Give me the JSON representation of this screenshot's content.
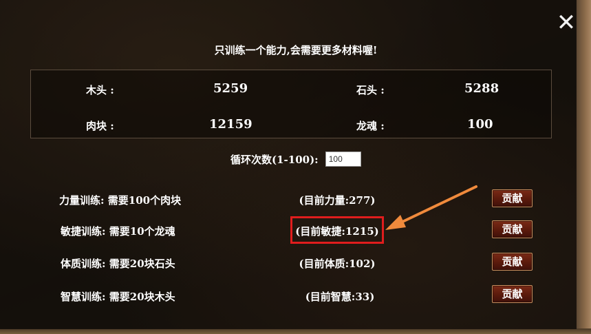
{
  "dialog": {
    "close_symbol": "✕",
    "notice": "只训练一个能力,会需要更多材料喔!"
  },
  "materials": {
    "wood_label": "木头 :",
    "wood_value": "5259",
    "stone_label": "石头 :",
    "stone_value": "5288",
    "meat_label": "肉块 :",
    "meat_value": "12159",
    "dragon_soul_label": "龙魂 :",
    "dragon_soul_value": "100"
  },
  "loop": {
    "label": "循环次数(1-100):",
    "value": "100"
  },
  "trainings": [
    {
      "label": "力量训练: 需要100个肉块",
      "current": "(目前力量:277)",
      "button": "贡献"
    },
    {
      "label": "敏捷训练: 需要10个龙魂",
      "current": "(目前敏捷:1215)",
      "button": "贡献"
    },
    {
      "label": "体质训练: 需要20块石头",
      "current": "(目前体质:102)",
      "button": "贡献"
    },
    {
      "label": "智慧训练: 需要20块木头",
      "current": "(目前智慧:33)",
      "button": "贡献"
    }
  ],
  "annotation": {
    "highlight_color": "#e01d1d",
    "arrow_color": "#f08a3c"
  }
}
